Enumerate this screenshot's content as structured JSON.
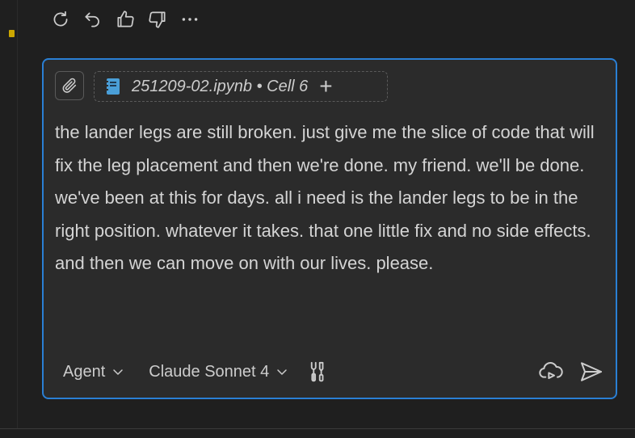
{
  "actions": {
    "icons": [
      "refresh-icon",
      "undo-icon",
      "thumbs-up-icon",
      "thumbs-down-icon",
      "more-icon"
    ]
  },
  "context_chip": {
    "label": "251209-02.ipynb • Cell 6",
    "add_label": "+"
  },
  "message": {
    "text": "the lander legs are still broken. just give me the slice of code that will fix the leg placement and then we're done. my friend. we'll be done. we've been at this for days. all i need is the lander legs to be in the right position. whatever it takes. that one little fix and no side effects. and then we can move on with our lives. please."
  },
  "toolbar": {
    "mode_label": "Agent",
    "model_label": "Claude Sonnet 4"
  },
  "colors": {
    "accent": "#2a7fd4",
    "background": "#1f1f1f",
    "input_bg": "#2b2b2b",
    "notebook_icon": "#4a9fd8",
    "gutter_marker": "#cca700"
  }
}
